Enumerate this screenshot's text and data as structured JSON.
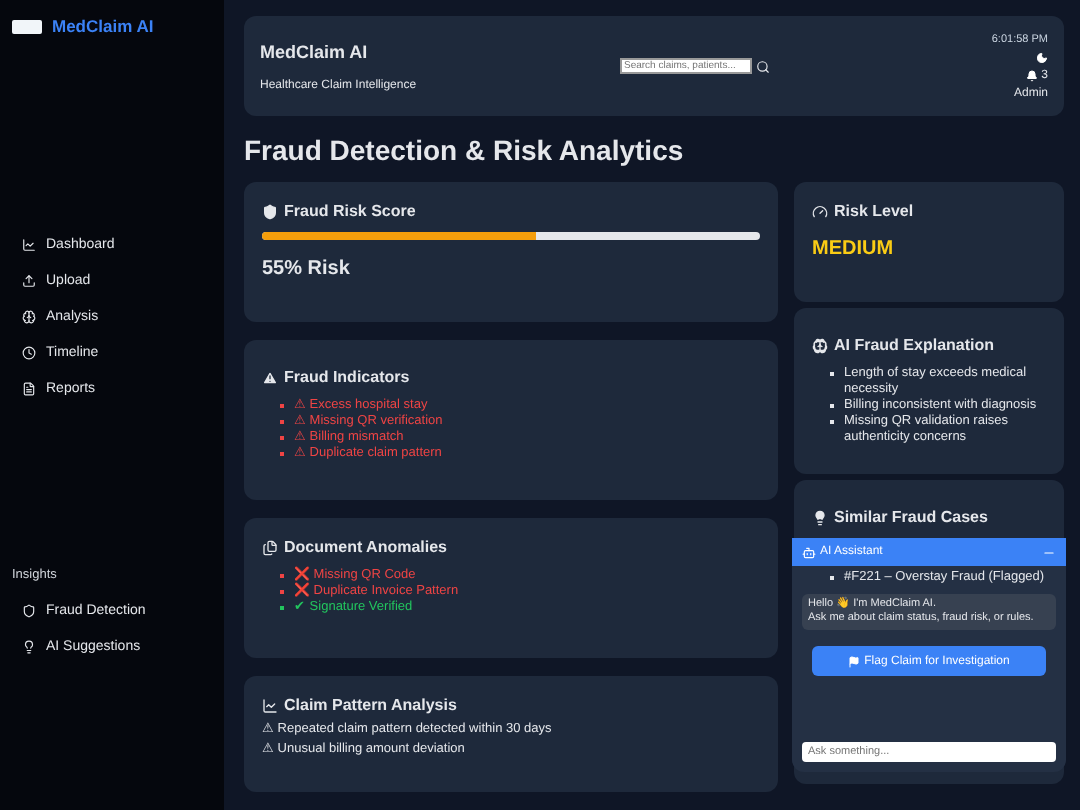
{
  "sidebar": {
    "brand": "MedClaim AI",
    "nav": [
      {
        "label": "Dashboard"
      },
      {
        "label": "Upload"
      },
      {
        "label": "Analysis"
      },
      {
        "label": "Timeline"
      },
      {
        "label": "Reports"
      }
    ],
    "section_title": "Insights",
    "insights": [
      {
        "label": "Fraud Detection"
      },
      {
        "label": "AI Suggestions"
      }
    ]
  },
  "header": {
    "title": "MedClaim AI",
    "subtitle": "Healthcare Claim Intelligence",
    "search": {
      "placeholder": "Search claims, patients..."
    },
    "time": "6:01:58 PM",
    "notifications": "3",
    "user": "Admin"
  },
  "page_title": "Fraud Detection & Risk Analytics",
  "risk_score": {
    "title": "Fraud Risk Score",
    "level": 0.55,
    "reading": "55% Risk"
  },
  "fraud_indicators": {
    "title": "Fraud Indicators",
    "items": [
      "⚠ Excess hospital stay",
      "⚠ Missing QR verification",
      "⚠ Billing mismatch",
      "⚠ Duplicate claim pattern"
    ]
  },
  "document_anomalies": {
    "title": "Document Anomalies",
    "items": [
      {
        "text": "❌ Missing QR Code",
        "kind": "fail"
      },
      {
        "text": "❌ Duplicate Invoice Pattern",
        "kind": "fail"
      },
      {
        "text": "✔ Signature Verified",
        "kind": "pass"
      }
    ]
  },
  "claim_pattern": {
    "title": "Claim Pattern Analysis",
    "items": [
      "⚠ Repeated claim pattern detected within 30 days",
      "⚠ Unusual billing amount deviation"
    ]
  },
  "risk_level": {
    "title": "Risk Level",
    "value": "MEDIUM"
  },
  "ai_explanation": {
    "title": "AI Fraud Explanation",
    "items": [
      "Length of stay exceeds medical necessity",
      "Billing inconsistent with diagnosis",
      "Missing QR validation raises authenticity concerns"
    ]
  },
  "similar_cases": {
    "title": "Similar Fraud Cases",
    "items": [
      "#F221 – Overstay Fraud (Flagged)"
    ],
    "action": "Flag Claim for Investigation"
  },
  "assistant": {
    "title": "AI Assistant",
    "message": "Hello 👋 I'm MedClaim AI.\nAsk me about claim status, fraud risk, or rules.",
    "input": {
      "placeholder": "Ask something..."
    }
  }
}
